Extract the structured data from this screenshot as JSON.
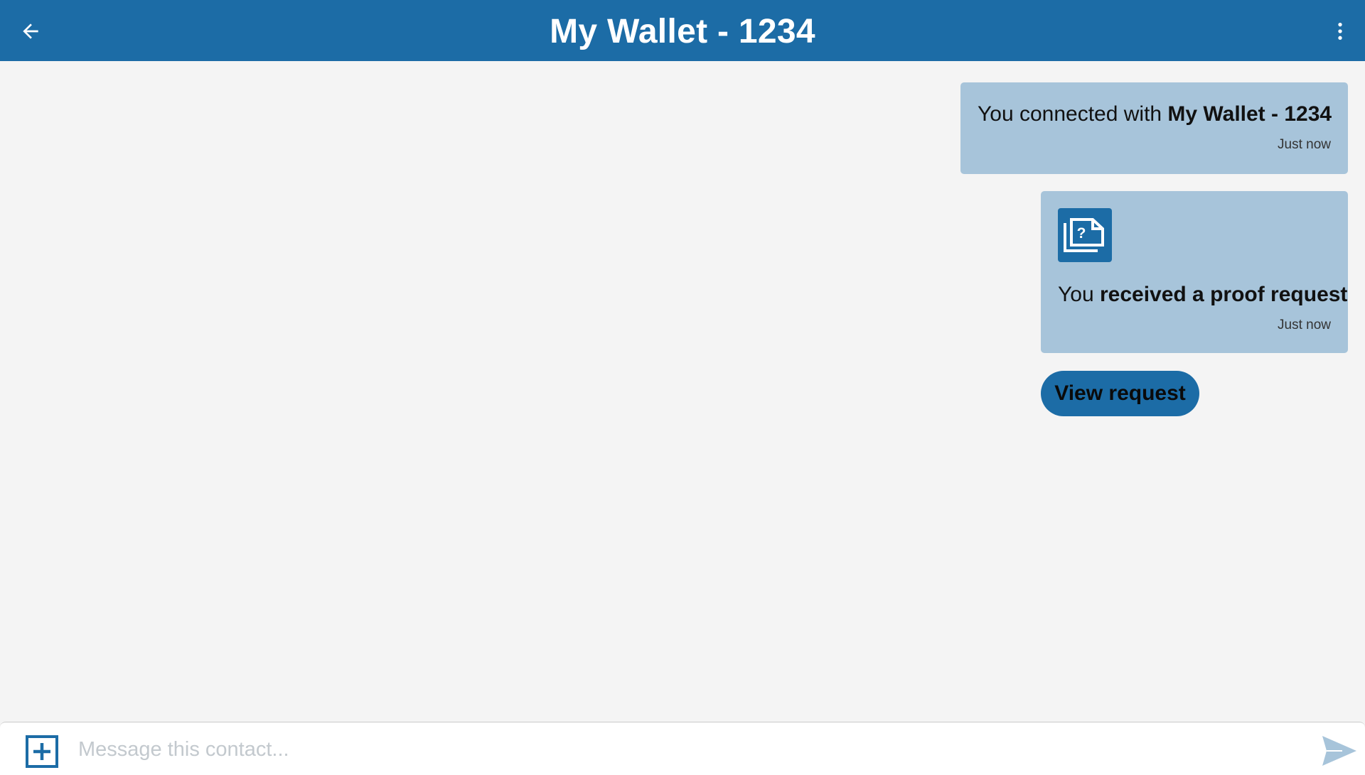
{
  "colors": {
    "primary": "#1c6ca6",
    "bubble": "#a7c4da",
    "background": "#f4f4f4",
    "placeholder": "#c3c9ce"
  },
  "header": {
    "title": "My Wallet - 1234",
    "back_icon": "arrow-left-icon",
    "menu_icon": "more-vertical-icon"
  },
  "messages": [
    {
      "prefix": "You connected with ",
      "emphasis": "My Wallet - 1234",
      "time": "Just now"
    },
    {
      "icon": "proof-request-icon",
      "prefix": "You ",
      "emphasis": "received a proof request",
      "time": "Just now",
      "action_label": "View request"
    }
  ],
  "composer": {
    "placeholder": "Message this contact...",
    "value": "",
    "attach_icon": "add-box-icon",
    "send_icon": "send-icon"
  }
}
